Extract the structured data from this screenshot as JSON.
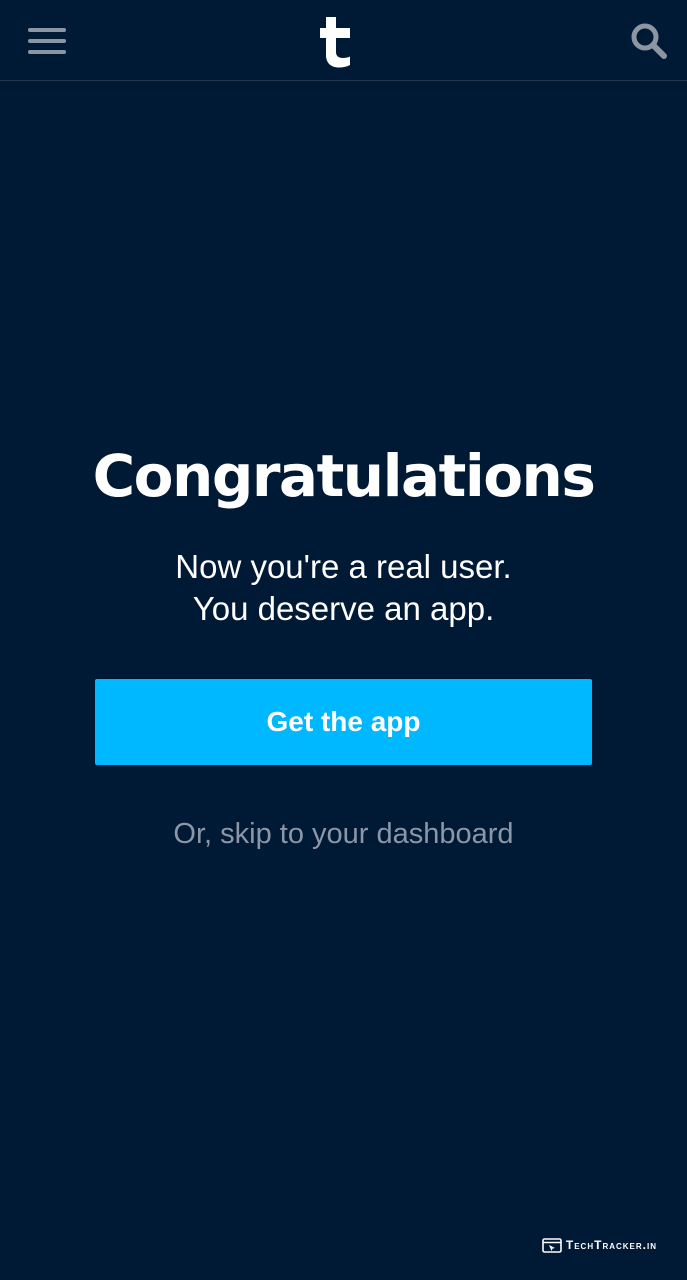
{
  "header": {
    "menu_icon": "hamburger-menu-icon",
    "logo_letter": "t",
    "search_icon": "search-icon"
  },
  "main": {
    "headline": "Congratulations",
    "subtext_line1": "Now you're a real user.",
    "subtext_line2": "You deserve an app.",
    "cta_label": "Get the app",
    "skip_link": "Or, skip to your dashboard"
  },
  "watermark": {
    "text": "TechTracker.in",
    "icon": "browser-window-icon"
  },
  "colors": {
    "background": "#001935",
    "accent_button": "#00b8ff",
    "muted_text": "#8b97a7",
    "text": "#ffffff"
  }
}
